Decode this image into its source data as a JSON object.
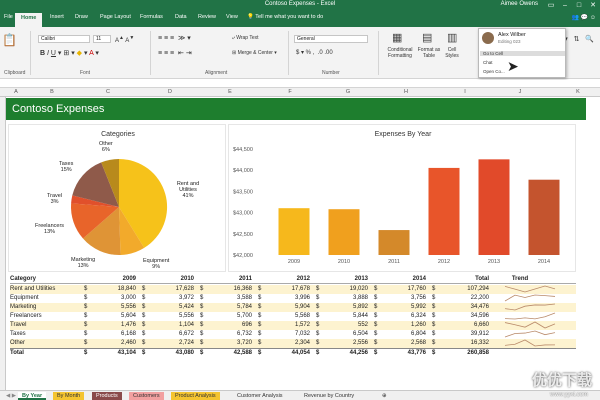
{
  "window": {
    "title": "Contoso Expenses - Excel",
    "user": "Aimee Owens"
  },
  "ribbon": {
    "tabs": [
      "File",
      "Home",
      "Insert",
      "Draw",
      "Page Layout",
      "Formulas",
      "Data",
      "Review",
      "View"
    ],
    "active_tab": "Home",
    "tell_me": "Tell me what you want to do",
    "font_name": "Calibri",
    "font_size": "11",
    "number_format": "General",
    "wrap_text": "Wrap Text",
    "merge_center": "Merge & Center",
    "conditional_formatting": "Conditional Formatting",
    "format_as_table": "Format as Table",
    "cell_styles": "Cell Styles",
    "groups": [
      "Clipboard",
      "Font",
      "Alignment",
      "Number"
    ]
  },
  "share_popup": {
    "name": "Alex Wilber",
    "status": "Editing 023",
    "items": [
      "Go to Cell",
      "Chat",
      "Open Co..."
    ]
  },
  "columns": [
    "A",
    "B",
    "C",
    "D",
    "E",
    "F",
    "G",
    "H",
    "I",
    "J",
    "K"
  ],
  "banner_title": "Contoso Expenses",
  "pie_chart": {
    "title": "Categories",
    "labels": [
      {
        "name": "Other",
        "pct": "6%"
      },
      {
        "name": "Taxes",
        "pct": "15%"
      },
      {
        "name": "Travel",
        "pct": "3%"
      },
      {
        "name": "Freelancers",
        "pct": "13%"
      },
      {
        "name": "Marketing",
        "pct": "13%"
      },
      {
        "name": "Equipment",
        "pct": "9%"
      },
      {
        "name": "Rent and Utilities",
        "pct": "41%"
      }
    ]
  },
  "chart_data": {
    "type": "bar",
    "title": "Expenses By Year",
    "categories": [
      "2009",
      "2010",
      "2011",
      "2012",
      "2013",
      "2014"
    ],
    "values": [
      43104,
      43080,
      42588,
      44054,
      44256,
      43776
    ],
    "ylim": [
      42000,
      44500
    ],
    "yticks": [
      "$44,500",
      "$44,000",
      "$43,500",
      "$43,000",
      "$42,500",
      "$42,000"
    ],
    "colors": [
      "#f6b81c",
      "#f0a01e",
      "#d4892a",
      "#e8552a",
      "#e14a2a",
      "#c4542e"
    ]
  },
  "table": {
    "headers": [
      "Category",
      "2009",
      "2010",
      "2011",
      "2012",
      "2013",
      "2014",
      "Total",
      "Trend"
    ],
    "rows": [
      [
        "Rent and Utilities",
        "18,840",
        "17,628",
        "16,368",
        "17,678",
        "19,020",
        "17,760",
        "107,294"
      ],
      [
        "Equipment",
        "3,000",
        "3,972",
        "3,588",
        "3,996",
        "3,888",
        "3,756",
        "22,200"
      ],
      [
        "Marketing",
        "5,556",
        "5,424",
        "5,784",
        "5,904",
        "5,892",
        "5,992",
        "34,476"
      ],
      [
        "Freelancers",
        "5,604",
        "5,556",
        "5,700",
        "5,568",
        "5,844",
        "6,324",
        "34,596"
      ],
      [
        "Travel",
        "1,476",
        "1,104",
        "696",
        "1,572",
        "552",
        "1,260",
        "6,660"
      ],
      [
        "Taxes",
        "6,168",
        "6,672",
        "6,732",
        "7,032",
        "6,504",
        "6,804",
        "39,912"
      ],
      [
        "Other",
        "2,460",
        "2,724",
        "3,720",
        "2,304",
        "2,556",
        "2,568",
        "16,332"
      ]
    ],
    "total_row": [
      "Total",
      "43,104",
      "43,080",
      "42,588",
      "44,054",
      "44,256",
      "43,776",
      "260,858"
    ]
  },
  "sheet_tabs": [
    "By Year",
    "By Month",
    "Products",
    "Customers",
    "Product Analysis",
    "Customer Analysis",
    "Revenue by Country"
  ],
  "watermark": "优优下载",
  "watermark_url": "www.yyxt.com"
}
